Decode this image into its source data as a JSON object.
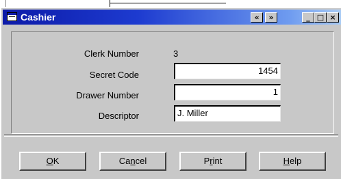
{
  "window": {
    "title": "Cashier",
    "nav_prev": "«",
    "nav_next": "»",
    "minimize": "_",
    "maximize": "□",
    "close": "×"
  },
  "form": {
    "clerk_number_label": "Clerk Number",
    "clerk_number_value": "3",
    "secret_code_label": "Secret Code",
    "secret_code_value": "1454",
    "drawer_number_label": "Drawer Number",
    "drawer_number_value": "1",
    "descriptor_label": "Descriptor",
    "descriptor_value": "J. Miller"
  },
  "buttons": {
    "ok_mnemonic": "O",
    "ok_rest": "K",
    "cancel_pre": "Ca",
    "cancel_mnemonic": "n",
    "cancel_rest": "cel",
    "print_pre": "P",
    "print_mnemonic": "r",
    "print_rest": "int",
    "help_mnemonic": "H",
    "help_rest": "elp"
  },
  "colors": {
    "titlebar_start": "#0c1aa8",
    "titlebar_end": "#a8cbf5",
    "face": "#c8c8c8"
  }
}
